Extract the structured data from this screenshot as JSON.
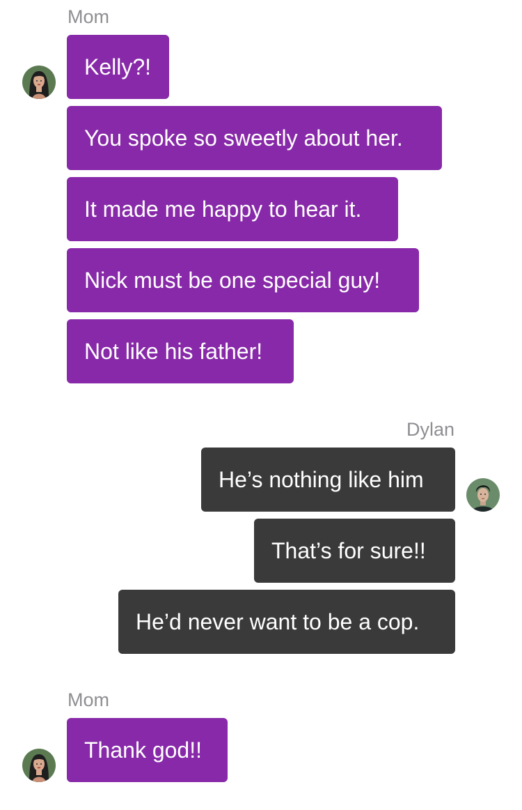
{
  "conversation": [
    {
      "sender": "Mom",
      "avatar_icon": "mom-avatar-icon",
      "bubble_color": "#8729a8",
      "messages": [
        "Kelly?!",
        "You spoke so sweetly about her.",
        "It made me happy to hear it.",
        "Nick must be one special guy!",
        "Not like his father!"
      ]
    },
    {
      "sender": "Dylan",
      "avatar_icon": "dylan-avatar-icon",
      "bubble_color": "#3a3a3a",
      "messages": [
        "He’s nothing like him",
        "That’s for sure!!",
        "He’d never want to be a cop."
      ]
    },
    {
      "sender": "Mom",
      "avatar_icon": "mom-avatar-icon",
      "bubble_color": "#8729a8",
      "messages": [
        "Thank god!!"
      ]
    }
  ]
}
